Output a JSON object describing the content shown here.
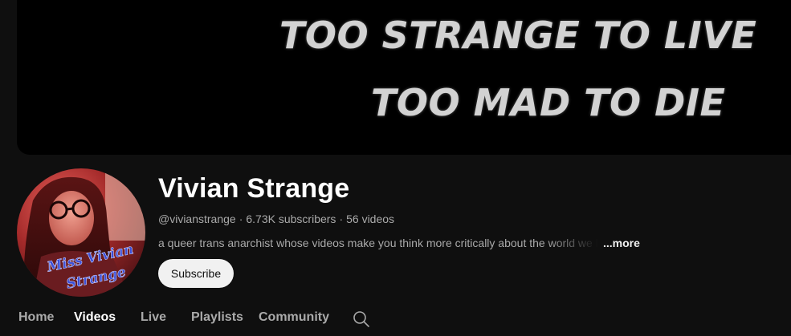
{
  "banner": {
    "line1": "TOO STRANGE TO LIVE",
    "line2": "TOO MAD TO DIE",
    "background_color": "#000000",
    "text_color": "#d2d2d2"
  },
  "channel": {
    "name": "Vivian Strange",
    "handle": "@vivianstrange",
    "separator": "·",
    "subscribers": "6.73K subscribers",
    "videos": "56 videos",
    "description": "a queer trans anarchist whose videos make you think more critically about the world we live in",
    "more_label": "...more",
    "avatar_signature": "Miss Vivian Strange"
  },
  "actions": {
    "subscribe_label": "Subscribe"
  },
  "tabs": [
    {
      "label": "Home",
      "active": false
    },
    {
      "label": "Videos",
      "active": true
    },
    {
      "label": "Live",
      "active": false
    },
    {
      "label": "Playlists",
      "active": false
    },
    {
      "label": "Community",
      "active": false
    }
  ],
  "icons": {
    "tab_search": "search-icon"
  },
  "theme": {
    "page_background": "#0f0f0f",
    "primary_text": "#f1f1f1",
    "secondary_text": "#aaaaaa",
    "button_background": "#f1f1f1",
    "button_text": "#0f0f0f"
  }
}
